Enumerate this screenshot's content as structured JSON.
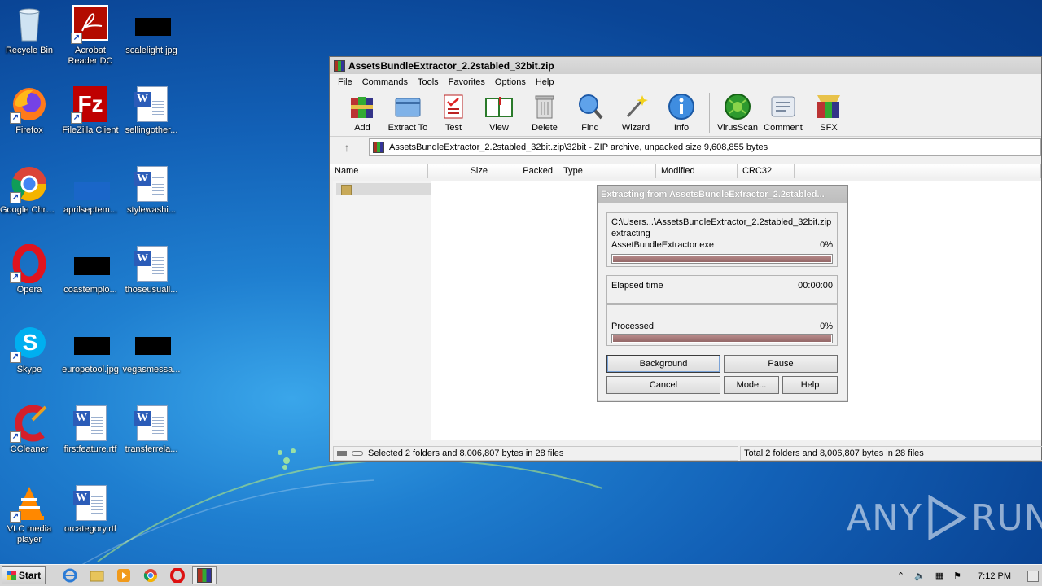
{
  "desktop_icons": [
    {
      "label": "Recycle Bin",
      "icon": "recycle-bin-icon"
    },
    {
      "label": "Acrobat Reader DC",
      "icon": "acrobat-icon"
    },
    {
      "label": "scalelight.jpg",
      "icon": "image-file-icon"
    },
    {
      "label": "Firefox",
      "icon": "firefox-icon"
    },
    {
      "label": "FileZilla Client",
      "icon": "filezilla-icon"
    },
    {
      "label": "sellingother...",
      "icon": "word-doc-icon"
    },
    {
      "label": "Google Chrome",
      "icon": "chrome-icon"
    },
    {
      "label": "aprilseptem...",
      "icon": "image-file-icon"
    },
    {
      "label": "stylewashi...",
      "icon": "word-doc-icon"
    },
    {
      "label": "Opera",
      "icon": "opera-icon"
    },
    {
      "label": "coastemplo...",
      "icon": "image-file-icon"
    },
    {
      "label": "thoseusuall...",
      "icon": "word-doc-icon"
    },
    {
      "label": "Skype",
      "icon": "skype-icon"
    },
    {
      "label": "europetool.jpg",
      "icon": "image-file-icon"
    },
    {
      "label": "vegasmessa...",
      "icon": "image-file-icon"
    },
    {
      "label": "CCleaner",
      "icon": "ccleaner-icon"
    },
    {
      "label": "firstfeature.rtf",
      "icon": "word-doc-icon"
    },
    {
      "label": "transferrela...",
      "icon": "word-doc-icon"
    },
    {
      "label": "VLC media player",
      "icon": "vlc-icon"
    },
    {
      "label": "orcategory.rtf",
      "icon": "word-doc-icon"
    }
  ],
  "winrar": {
    "title": "AssetsBundleExtractor_2.2stabled_32bit.zip",
    "menu": [
      "File",
      "Commands",
      "Tools",
      "Favorites",
      "Options",
      "Help"
    ],
    "toolbar": [
      "Add",
      "Extract To",
      "Test",
      "View",
      "Delete",
      "Find",
      "Wizard",
      "Info",
      "VirusScan",
      "Comment",
      "SFX"
    ],
    "address": "AssetsBundleExtractor_2.2stabled_32bit.zip\\32bit - ZIP archive, unpacked size 9,608,855 bytes",
    "columns": [
      "Name",
      "Size",
      "Packed",
      "Type",
      "Modified",
      "CRC32"
    ],
    "status_left": "Selected 2 folders and 8,006,807 bytes in 28 files",
    "status_right": "Total 2 folders and 8,006,807 bytes in 28 files"
  },
  "dialog": {
    "title": "Extracting from AssetsBundleExtractor_2.2stabled...",
    "path": "C:\\Users...\\AssetsBundleExtractor_2.2stabled_32bit.zip",
    "action": "extracting",
    "file": "AssetBundleExtractor.exe",
    "file_percent": "0%",
    "file_progress": 1.0,
    "elapsed_label": "Elapsed time",
    "elapsed_value": "00:00:00",
    "processed_label": "Processed",
    "processed_percent": "0%",
    "processed_progress": 1.0,
    "buttons": {
      "background": "Background",
      "pause": "Pause",
      "cancel": "Cancel",
      "mode": "Mode...",
      "help": "Help"
    }
  },
  "taskbar": {
    "start": "Start",
    "clock": "7:12 PM"
  },
  "watermark": {
    "left": "ANY",
    "right": "RUN"
  }
}
